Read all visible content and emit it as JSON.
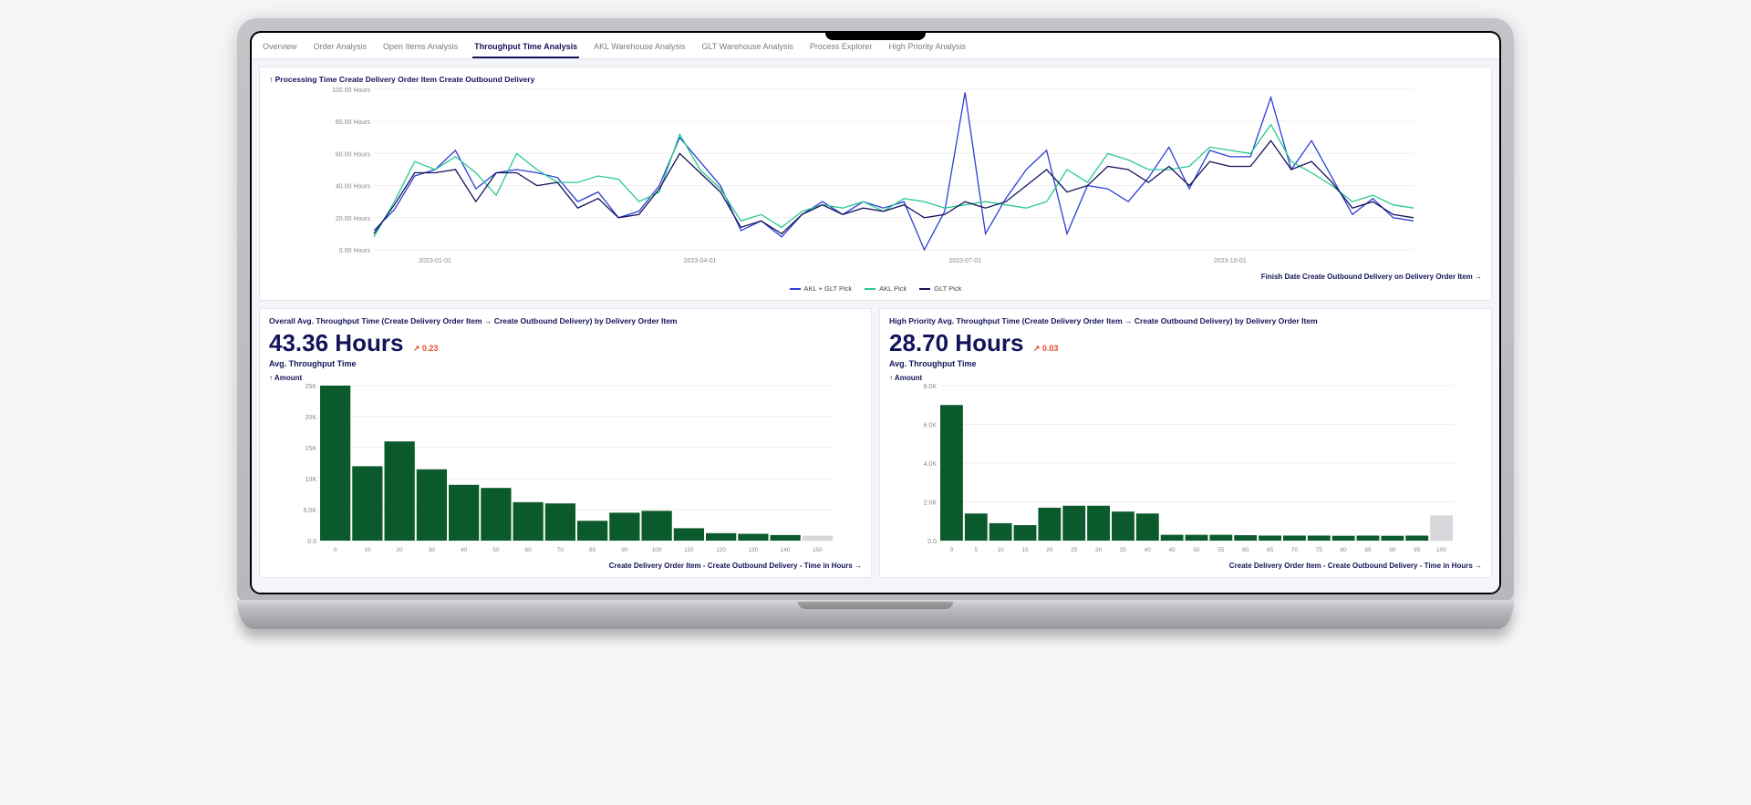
{
  "tabs": [
    {
      "label": "Overview",
      "active": false
    },
    {
      "label": "Order Analysis",
      "active": false
    },
    {
      "label": "Open Items Analysis",
      "active": false
    },
    {
      "label": "Throughput Time Analysis",
      "active": true
    },
    {
      "label": "AKL Warehouse Analysis",
      "active": false
    },
    {
      "label": "GLT Warehouse Analysis",
      "active": false
    },
    {
      "label": "Process Explorer",
      "active": false
    },
    {
      "label": "High Priority Analysis",
      "active": false
    }
  ],
  "top_chart": {
    "title": "↑ Processing Time Create Delivery Order Item Create Outbound Delivery",
    "footer": "Finish Date Create Outbound Delivery on Delivery Order Item →",
    "legend": [
      "AKL + GLT Pick",
      "AKL Pick",
      "GLT Pick"
    ],
    "legend_colors": [
      "#2a3ed6",
      "#28c990",
      "#14145a"
    ]
  },
  "left_card": {
    "title": "Overall Avg. Throughput Time (Create Delivery Order Item → Create Outbound Delivery) by Delivery Order Item",
    "metric": "43.36 Hours",
    "delta": "0.23",
    "sub": "Avg. Throughput Time",
    "ylabel": "↑ Amount",
    "footer": "Create Delivery Order Item - Create Outbound Delivery - Time in Hours →"
  },
  "right_card": {
    "title": "High Priority Avg. Throughput Time (Create Delivery Order Item → Create Outbound Delivery) by Delivery Order Item",
    "metric": "28.70 Hours",
    "delta": "0.03",
    "sub": "Avg. Throughput Time",
    "ylabel": "↑ Amount",
    "footer": "Create Delivery Order Item - Create Outbound Delivery - Time in Hours →"
  },
  "chart_data": [
    {
      "type": "line",
      "title": "Processing Time Create Delivery Order Item Create Outbound Delivery",
      "xlabel": "Finish Date Create Outbound Delivery on Delivery Order Item",
      "ylabel": "Hours",
      "ylim": [
        0,
        100
      ],
      "y_ticks": [
        0,
        20,
        40,
        60,
        80,
        100
      ],
      "y_tick_labels": [
        "0.00 Hours",
        "20.00 Hours",
        "40.00 Hours",
        "60.00 Hours",
        "80.00 Hours",
        "100.00 Hours"
      ],
      "x_tick_labels": [
        "2023-01-01",
        "2023-04-01",
        "2023-07-01",
        "2023-10-01"
      ],
      "x_tick_positions": [
        3,
        16,
        29,
        42
      ],
      "series": [
        {
          "name": "AKL + GLT Pick",
          "color": "#2a3ed6",
          "values": [
            12,
            25,
            46,
            50,
            62,
            38,
            48,
            50,
            48,
            45,
            30,
            36,
            20,
            24,
            40,
            70,
            55,
            40,
            12,
            18,
            8,
            22,
            30,
            22,
            30,
            26,
            30,
            0,
            24,
            98,
            10,
            32,
            50,
            62,
            10,
            40,
            38,
            30,
            45,
            64,
            38,
            62,
            58,
            58,
            95,
            50,
            68,
            45,
            22,
            32,
            20,
            18
          ]
        },
        {
          "name": "AKL Pick",
          "color": "#28c990",
          "values": [
            8,
            30,
            55,
            50,
            58,
            48,
            34,
            60,
            50,
            42,
            42,
            46,
            44,
            30,
            36,
            72,
            50,
            38,
            18,
            22,
            14,
            24,
            28,
            26,
            30,
            24,
            32,
            30,
            26,
            28,
            30,
            28,
            26,
            30,
            50,
            42,
            60,
            56,
            50,
            50,
            52,
            64,
            62,
            60,
            78,
            55,
            48,
            40,
            30,
            34,
            28,
            26
          ]
        },
        {
          "name": "GLT Pick",
          "color": "#14145a",
          "values": [
            10,
            28,
            48,
            48,
            50,
            30,
            48,
            48,
            40,
            42,
            26,
            32,
            20,
            22,
            38,
            60,
            48,
            36,
            14,
            18,
            10,
            22,
            28,
            22,
            26,
            24,
            28,
            20,
            22,
            30,
            26,
            30,
            40,
            50,
            36,
            40,
            52,
            50,
            42,
            52,
            40,
            55,
            52,
            52,
            68,
            50,
            55,
            42,
            26,
            30,
            22,
            20
          ]
        }
      ]
    },
    {
      "type": "bar",
      "title": "Overall Avg. Throughput Time histogram",
      "xlabel": "Time in Hours",
      "ylabel": "Amount",
      "ylim": [
        0,
        25000
      ],
      "y_ticks": [
        0,
        5000,
        10000,
        15000,
        20000,
        25000
      ],
      "y_tick_labels": [
        "0.0",
        "5.0K",
        "10K",
        "15K",
        "20K",
        "25K"
      ],
      "categories": [
        "0",
        "10",
        "20",
        "30",
        "40",
        "50",
        "60",
        "70",
        "80",
        "90",
        "100",
        "110",
        "120",
        "130",
        "140",
        "150"
      ],
      "values": [
        25000,
        12000,
        16000,
        11500,
        9000,
        8500,
        6200,
        6000,
        3200,
        4500,
        4800,
        2000,
        1200,
        1100,
        900,
        800
      ],
      "color": "#0b5a2b",
      "last_gray": true
    },
    {
      "type": "bar",
      "title": "High Priority Avg. Throughput Time histogram",
      "xlabel": "Time in Hours",
      "ylabel": "Amount",
      "ylim": [
        0,
        8000
      ],
      "y_ticks": [
        0,
        2000,
        4000,
        6000,
        8000
      ],
      "y_tick_labels": [
        "0.0",
        "2.0K",
        "4.0K",
        "6.0K",
        "8.0K"
      ],
      "categories": [
        "0",
        "5",
        "10",
        "15",
        "20",
        "25",
        "30",
        "35",
        "40",
        "45",
        "50",
        "55",
        "60",
        "65",
        "70",
        "75",
        "80",
        "85",
        "90",
        "95",
        "100"
      ],
      "values": [
        7000,
        1400,
        900,
        800,
        1700,
        1800,
        1800,
        1500,
        1400,
        300,
        300,
        300,
        280,
        260,
        260,
        260,
        250,
        260,
        250,
        260,
        1300
      ],
      "color": "#0b5a2b",
      "last_gray": true
    }
  ]
}
